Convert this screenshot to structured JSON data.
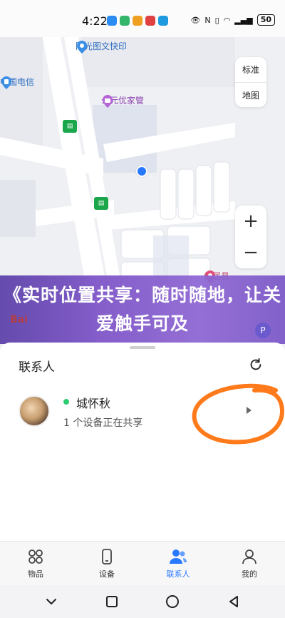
{
  "status_bar": {
    "time": "4:22",
    "battery": "50",
    "app_icon_colors": [
      "#2a8cf0",
      "#33b56a",
      "#f0a020",
      "#e04040",
      "#1e9be0"
    ]
  },
  "map": {
    "pois": {
      "print_shop": "阳光图文快印",
      "china_telecom": "中国电信",
      "youjia": "公元优家管",
      "partial_place": "仙居县"
    },
    "map_type": {
      "standard": "标准",
      "layers": "地图"
    },
    "zoom": {
      "in": "+",
      "out": "−"
    },
    "baidu_logo": "Bai",
    "parking": "P"
  },
  "banner": {
    "text": "《实时位置共享：随时随地，让关爱触手可及"
  },
  "contacts_panel": {
    "title": "联系人",
    "contact": {
      "name": "城怀秋",
      "status": "1 个设备正在共享"
    }
  },
  "bottom_nav": {
    "items": [
      {
        "label": "物品",
        "icon": "grid-icon"
      },
      {
        "label": "设备",
        "icon": "phone-icon"
      },
      {
        "label": "联系人",
        "icon": "contacts-icon",
        "active": true
      },
      {
        "label": "我的",
        "icon": "person-icon"
      }
    ]
  },
  "colors": {
    "accent": "#2979ff",
    "banner": "#7c52c7",
    "scribble": "#ff7a1a",
    "online": "#2ecc71"
  }
}
